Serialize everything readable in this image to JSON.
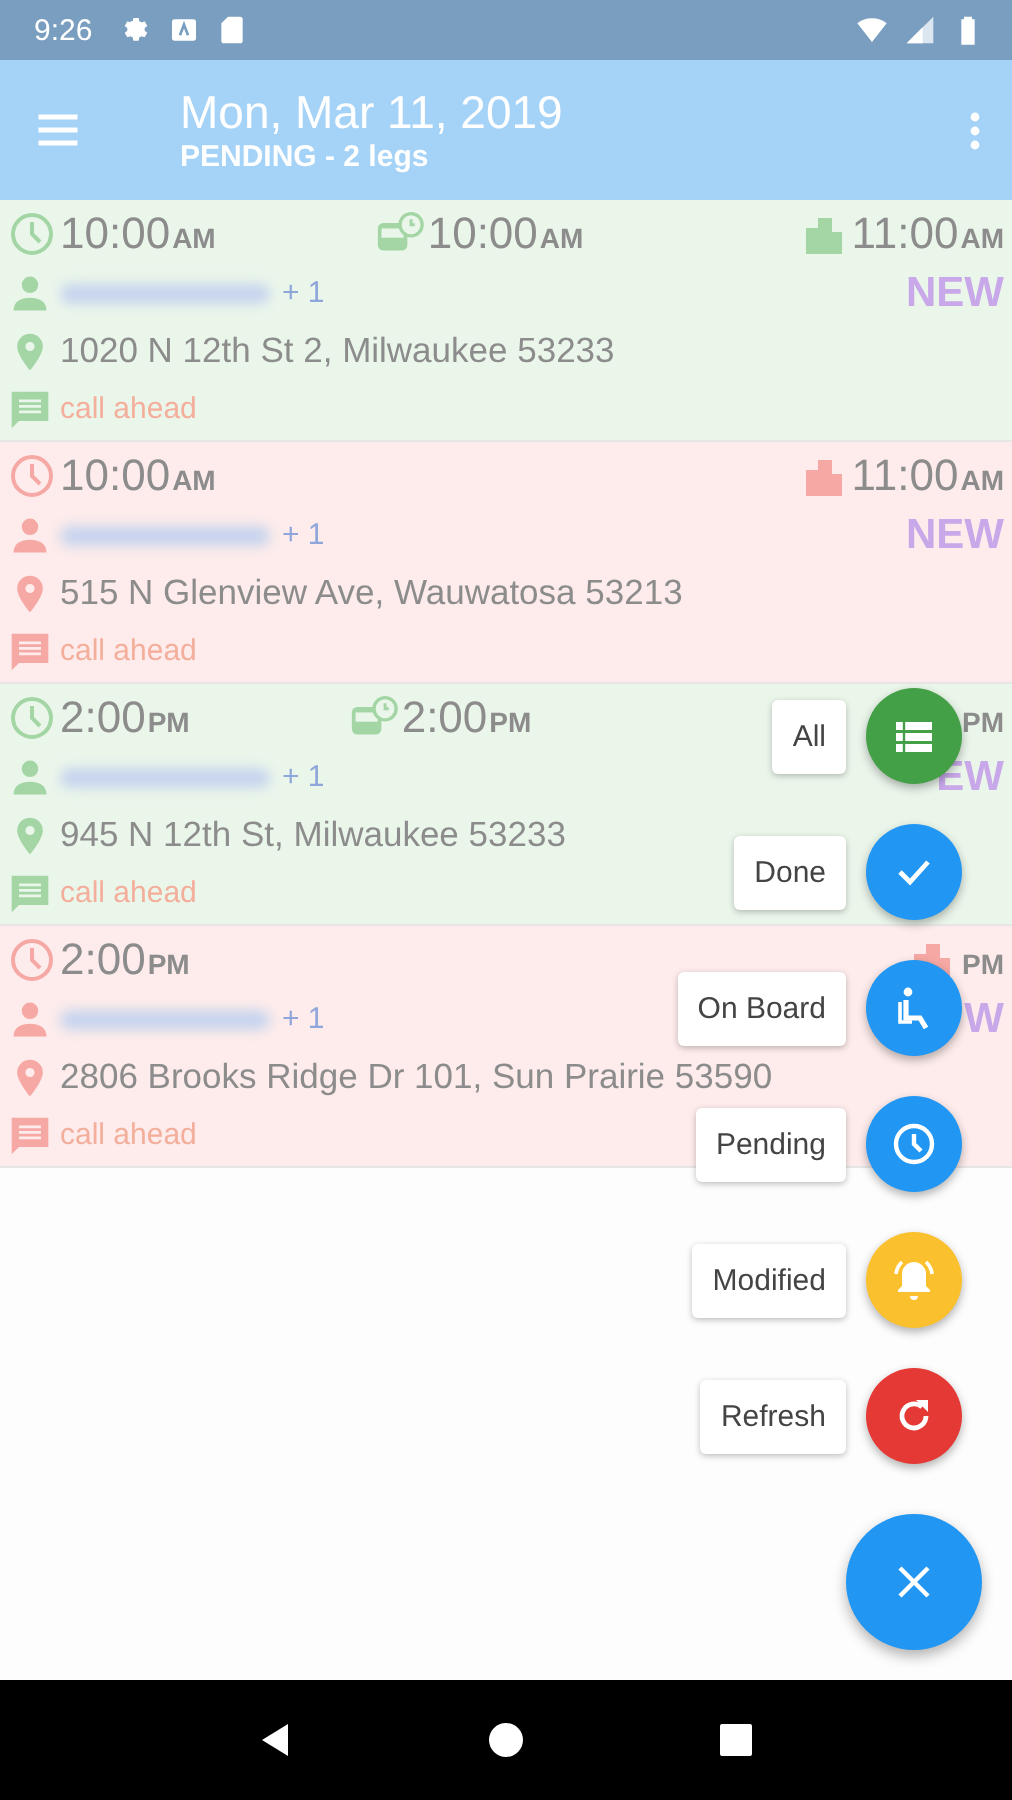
{
  "status_bar": {
    "time": "9:26"
  },
  "app_bar": {
    "title": "Mon, Mar 11, 2019",
    "subtitle": "PENDING - 2 legs"
  },
  "legs": [
    {
      "color": "#a3d6a4",
      "start": {
        "time": "10:00",
        "ampm": "AM"
      },
      "pickup": {
        "time": "10:00",
        "ampm": "AM"
      },
      "dropoff": {
        "time": "11:00",
        "ampm": "AM"
      },
      "extra": "+ 1",
      "badge": "NEW",
      "address": "1020 N 12th St 2, Milwaukee 53233",
      "note": "call ahead"
    },
    {
      "color": "#f6a8a4",
      "start": {
        "time": "10:00",
        "ampm": "AM"
      },
      "dropoff": {
        "time": "11:00",
        "ampm": "AM"
      },
      "extra": "+ 1",
      "badge": "NEW",
      "address": "515 N Glenview Ave, Wauwatosa 53213",
      "note": "call ahead"
    },
    {
      "color": "#a3d6a4",
      "start": {
        "time": "2:00",
        "ampm": "PM"
      },
      "pickup": {
        "time": "2:00",
        "ampm": "PM"
      },
      "dropoff": {
        "ampm": "PM",
        "icon_covered": true
      },
      "extra": "+ 1",
      "badge": "EW",
      "address": "945 N 12th St, Milwaukee 53233",
      "note": "call ahead"
    },
    {
      "color": "#f6a8a4",
      "start": {
        "time": "2:00",
        "ampm": "PM"
      },
      "dropoff": {
        "ampm": "PM"
      },
      "extra": "+ 1",
      "badge": "W",
      "address": "2806 Brooks Ridge Dr 101, Sun Prairie 53590",
      "note": "call ahead"
    }
  ],
  "fab_menu": [
    {
      "label": "All",
      "kind": "list",
      "color": "#43a047"
    },
    {
      "label": "Done",
      "kind": "check",
      "color": "#2196f3"
    },
    {
      "label": "On Board",
      "kind": "seat",
      "color": "#2196f3"
    },
    {
      "label": "Pending",
      "kind": "clock",
      "color": "#2196f3"
    },
    {
      "label": "Modified",
      "kind": "bell",
      "color": "#fbc02d"
    },
    {
      "label": "Refresh",
      "kind": "refresh",
      "color": "#e53935"
    }
  ]
}
